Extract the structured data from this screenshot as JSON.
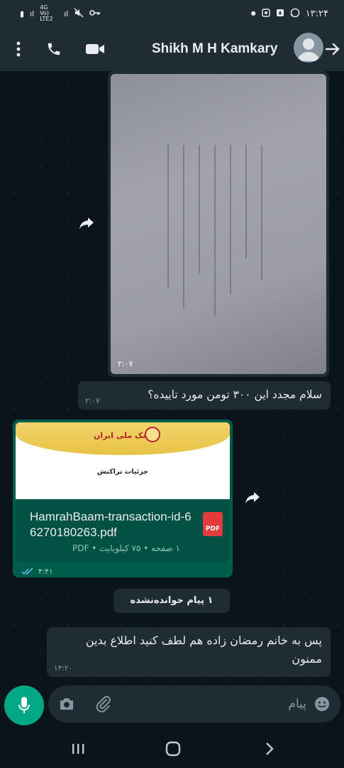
{
  "status_bar": {
    "time": "۱۳:۲۴",
    "network": "4G Vo) LTE2",
    "icons": [
      "sim-icon",
      "signal-icon",
      "network-icon",
      "signal-icon",
      "mute-icon",
      "key-icon",
      "dot-icon",
      "gallery-icon",
      "download-icon",
      "whatsapp-icon"
    ]
  },
  "header": {
    "contact_name": "Shikh M H Kamkary",
    "icons": [
      "menu-dots-icon",
      "phone-icon",
      "video-icon",
      "avatar-icon",
      "back-arrow-icon"
    ]
  },
  "chat": {
    "image_message": {
      "time": "۲:۰۷"
    },
    "text_message": {
      "text": "سلام مجدد این ۳۰۰ تومن مورد تاییده؟",
      "time": "۲:۰۷"
    },
    "document_message": {
      "bank_name": "بانک ملی ایران",
      "thumb_title": "جزئیات تراکنش",
      "file_name": "HamrahBaam-transaction-id-66270180263.pdf",
      "file_type_badge": "PDF",
      "file_meta": "۱ صفحه • ۷۵ کیلوبایت • PDF",
      "time": "۴:۴۱",
      "status": "read"
    },
    "unread_divider": "۱ پیام خوانده‌نشده",
    "last_message": {
      "text": "پس به خانم رمضان زاده هم لطف کنید اطلاع بدین ممنون",
      "time": "۱۳:۲۰"
    }
  },
  "input_bar": {
    "placeholder": "پیام",
    "icons": [
      "mic-icon",
      "camera-icon",
      "attach-icon",
      "emoji-icon"
    ]
  },
  "colors": {
    "header_bg": "#1f2c33",
    "chat_bg": "#0b141a",
    "incoming_bubble": "#1f2c33",
    "outgoing_bubble": "#005c4b",
    "accent": "#00a884",
    "read_ticks": "#53bdeb"
  }
}
